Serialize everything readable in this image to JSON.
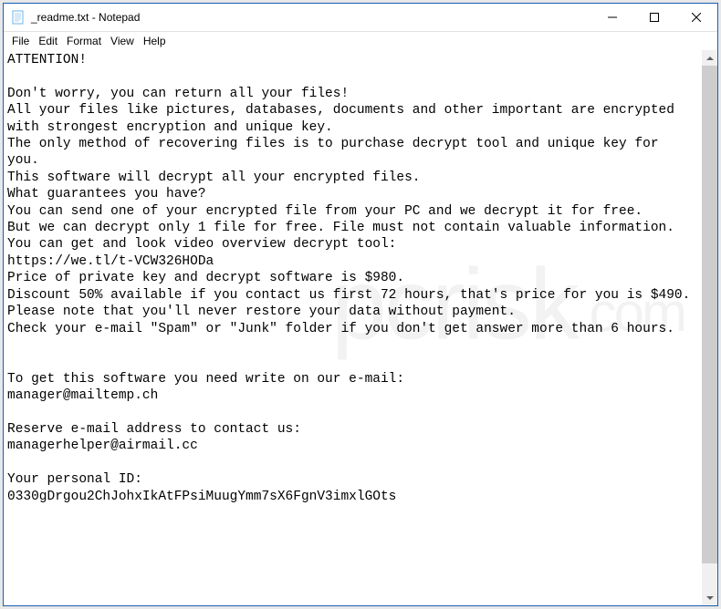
{
  "window": {
    "title": "_readme.txt - Notepad"
  },
  "menu": {
    "file": "File",
    "edit": "Edit",
    "format": "Format",
    "view": "View",
    "help": "Help"
  },
  "content": {
    "text": "ATTENTION!\n\nDon't worry, you can return all your files!\nAll your files like pictures, databases, documents and other important are encrypted with strongest encryption and unique key.\nThe only method of recovering files is to purchase decrypt tool and unique key for you.\nThis software will decrypt all your encrypted files.\nWhat guarantees you have?\nYou can send one of your encrypted file from your PC and we decrypt it for free.\nBut we can decrypt only 1 file for free. File must not contain valuable information.\nYou can get and look video overview decrypt tool:\nhttps://we.tl/t-VCW326HODa\nPrice of private key and decrypt software is $980.\nDiscount 50% available if you contact us first 72 hours, that's price for you is $490.\nPlease note that you'll never restore your data without payment.\nCheck your e-mail \"Spam\" or \"Junk\" folder if you don't get answer more than 6 hours.\n\n\nTo get this software you need write on our e-mail:\nmanager@mailtemp.ch\n\nReserve e-mail address to contact us:\nmanagerhelper@airmail.cc\n\nYour personal ID:\n0330gDrgou2ChJohxIkAtFPsiMuugYmm7sX6FgnV3imxlGOts"
  },
  "watermark": {
    "text": "pcrisk",
    "suffix": ".com"
  }
}
